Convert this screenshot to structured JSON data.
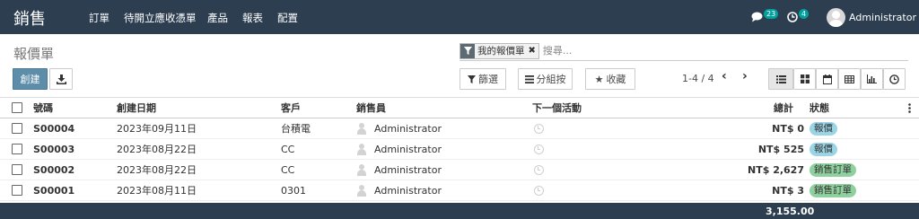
{
  "navbar": {
    "app_name": "銷售",
    "menu": [
      "訂單",
      "待開立應收憑單",
      "產品",
      "報表",
      "配置"
    ],
    "messages_count": "23",
    "activities_count": "4",
    "user_name": "Administrator"
  },
  "control": {
    "breadcrumb": "報價單",
    "create_label": "創建",
    "filters_label": "篩選",
    "groupby_label": "分組按",
    "favorites_label": "收藏",
    "pager_value": "1-4 / 4"
  },
  "search": {
    "facet_label": "我的報價單",
    "placeholder": "搜尋..."
  },
  "table": {
    "headers": {
      "number": "號碼",
      "create_date": "創建日期",
      "customer": "客戶",
      "salesperson": "銷售員",
      "next_activity": "下一個活動",
      "total": "總計",
      "status": "狀態"
    },
    "rows": [
      {
        "number": "S00004",
        "date": "2023年09月11日",
        "customer": "台積電",
        "salesperson": "Administrator",
        "total": "NT$ 0",
        "status": "報價"
      },
      {
        "number": "S00003",
        "date": "2023年08月22日",
        "customer": "CC",
        "salesperson": "Administrator",
        "total": "NT$ 525",
        "status": "報價"
      },
      {
        "number": "S00002",
        "date": "2023年08月22日",
        "customer": "CC",
        "salesperson": "Administrator",
        "total": "NT$ 2,627",
        "status": "銷售訂單"
      },
      {
        "number": "S00001",
        "date": "2023年08月11日",
        "customer": "0301",
        "salesperson": "Administrator",
        "total": "NT$ 3",
        "status": "銷售訂單"
      }
    ],
    "grand_total": "3,155.00"
  },
  "colors": {
    "navbar": "#2c3e50",
    "primary": "#5d8da8",
    "quotation_badge": "#9ad5e6",
    "sale_order_badge": "#8fd19e"
  }
}
